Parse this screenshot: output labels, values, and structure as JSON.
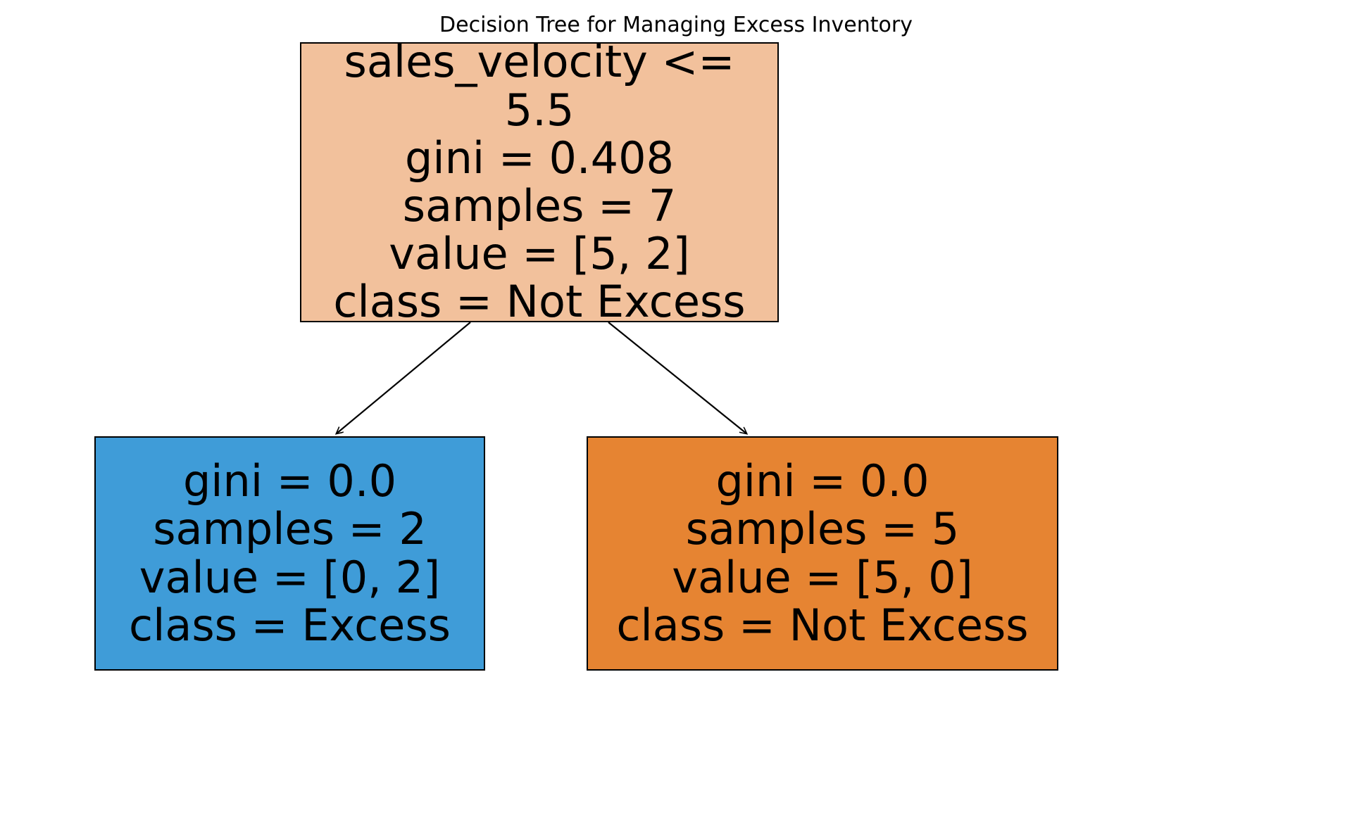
{
  "title": "Decision Tree for Managing Excess Inventory",
  "chart_data": {
    "type": "decision_tree",
    "title": "Decision Tree for Managing Excess Inventory",
    "feature_names": [
      "sales_velocity"
    ],
    "class_names": [
      "Not Excess",
      "Excess"
    ],
    "nodes": [
      {
        "id": 0,
        "condition": "sales_velocity <= 5.5",
        "gini": 0.408,
        "samples": 7,
        "value": [
          5,
          2
        ],
        "class": "Not Excess",
        "children": [
          1,
          2
        ]
      },
      {
        "id": 1,
        "gini": 0.0,
        "samples": 2,
        "value": [
          0,
          2
        ],
        "class": "Excess",
        "leaf": true
      },
      {
        "id": 2,
        "gini": 0.0,
        "samples": 5,
        "value": [
          5,
          0
        ],
        "class": "Not Excess",
        "leaf": true
      }
    ]
  },
  "root": {
    "line1": "sales_velocity <= 5.5",
    "line2": "gini = 0.408",
    "line3": "samples = 7",
    "line4": "value = [5, 2]",
    "line5": "class = Not Excess"
  },
  "left": {
    "line1": "gini = 0.0",
    "line2": "samples = 2",
    "line3": "value = [0, 2]",
    "line4": "class = Excess"
  },
  "right": {
    "line1": "gini = 0.0",
    "line2": "samples = 5",
    "line3": "value = [5, 0]",
    "line4": "class = Not Excess"
  },
  "colors": {
    "root_fill": "#f2c19c",
    "left_fill": "#3f9cd8",
    "right_fill": "#e68432",
    "stroke": "#000000"
  }
}
